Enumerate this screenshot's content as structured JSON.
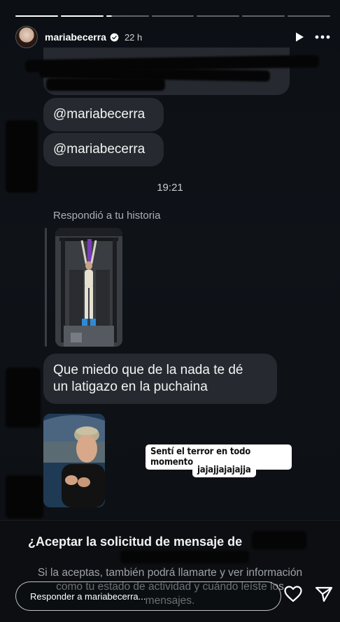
{
  "story": {
    "segments": [
      "done",
      "done",
      "part",
      "empty",
      "empty",
      "empty",
      "empty"
    ]
  },
  "header": {
    "username": "mariabecerra",
    "time_ago": "22 h",
    "verified": true,
    "icons": [
      "play-icon",
      "more-icon"
    ]
  },
  "chat": {
    "mention_1": "@mariabecerra",
    "mention_2": "@mariabecerra",
    "timestamp": "19:21",
    "replied_label": "Respondió a tu historia",
    "message_line_1": "Que miedo que de la nada te dé",
    "message_line_2": "un latigazo en la puchaina",
    "video_caption_1": "Sentí el terror en todo momento",
    "video_caption_2": "jajajjajajajja"
  },
  "request": {
    "title": "¿Aceptar la solicitud de mensaje de",
    "body_line_1": "Si la aceptas, también podrá llamarte y ver información",
    "body_line_2": "como tu estado de actividad y cuándo leíste los",
    "body_line_3": "mensajes."
  },
  "footer": {
    "reply_placeholder": "Responder a mariabecerra...",
    "icons": [
      "heart-icon",
      "send-icon"
    ]
  },
  "colors": {
    "background": "#0b0d10",
    "bubble": "#262a30",
    "muted_text": "#9ea3a8"
  }
}
